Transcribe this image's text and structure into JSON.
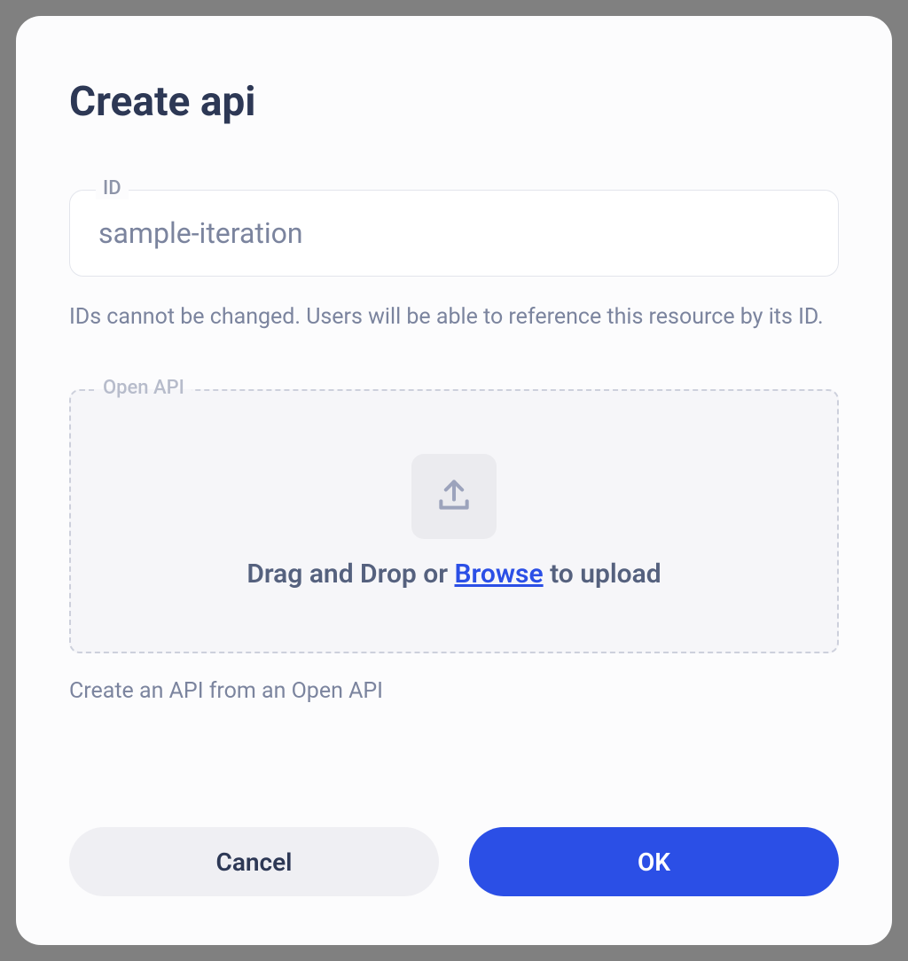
{
  "modal": {
    "title": "Create api",
    "id_field": {
      "label": "ID",
      "value": "sample-iteration",
      "helper": "IDs cannot be changed. Users will be able to reference this resource by its ID."
    },
    "dropzone": {
      "label": "Open API",
      "text_prefix": "Drag and Drop or ",
      "browse_label": "Browse",
      "text_suffix": " to upload",
      "helper": "Create an API from an Open API"
    },
    "buttons": {
      "cancel": "Cancel",
      "ok": "OK"
    }
  }
}
